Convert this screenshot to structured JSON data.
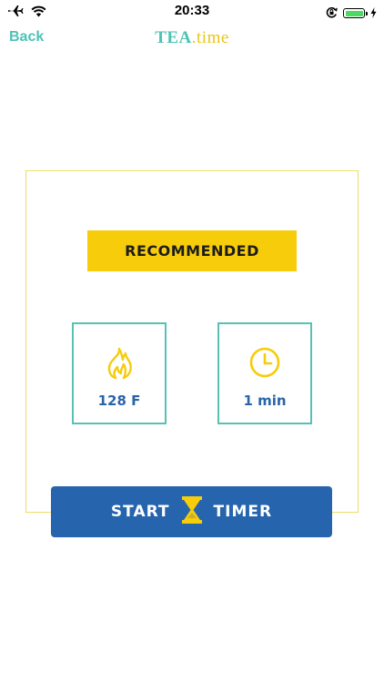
{
  "status_bar": {
    "time": "20:33",
    "icons": [
      "airplane-icon",
      "wifi-icon",
      "orientation-lock-icon",
      "battery-icon",
      "charging-bolt-icon"
    ],
    "battery_color": "#4cd964",
    "battery_level": 1.0
  },
  "nav": {
    "back_label": "Back",
    "title_main": "TEA",
    "title_suffix": ".time",
    "accent_teal": "#4fc2b6",
    "accent_yellow": "#e8c518"
  },
  "card": {
    "banner_label": "RECOMMENDED",
    "banner_color": "#f7cc0a",
    "temperature": {
      "icon": "flame-icon",
      "value": "128 F"
    },
    "duration": {
      "icon": "clock-icon",
      "value": "1 min"
    },
    "box_border_color": "#58c1b4",
    "value_color": "#2a65aa"
  },
  "timer_button": {
    "label_left": "START",
    "icon": "hourglass-icon",
    "label_right": "TIMER",
    "color": "#2664ad"
  }
}
